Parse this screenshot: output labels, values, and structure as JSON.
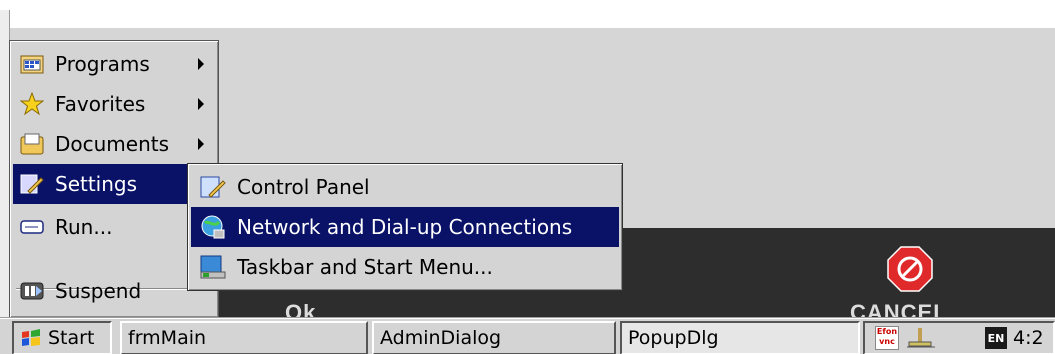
{
  "start_menu": {
    "items": [
      {
        "label": "Programs",
        "icon": "programs-icon",
        "has_submenu": true
      },
      {
        "label": "Favorites",
        "icon": "favorites-icon",
        "has_submenu": true
      },
      {
        "label": "Documents",
        "icon": "documents-icon",
        "has_submenu": true
      },
      {
        "label": "Settings",
        "icon": "settings-icon",
        "has_submenu": true,
        "selected": true
      },
      {
        "label": "Run...",
        "icon": "run-icon",
        "has_submenu": false
      },
      {
        "label": "Suspend",
        "icon": "suspend-icon",
        "has_submenu": false
      }
    ]
  },
  "settings_submenu": {
    "items": [
      {
        "label": "Control Panel",
        "icon": "control-panel-icon"
      },
      {
        "label": "Network and Dial-up Connections",
        "icon": "network-icon",
        "selected": true
      },
      {
        "label": "Taskbar and Start Menu...",
        "icon": "taskbar-icon"
      }
    ]
  },
  "taskbar": {
    "start_label": "Start",
    "buttons": [
      {
        "label": "frmMain"
      },
      {
        "label": "AdminDialog"
      },
      {
        "label": "PopupDlg",
        "pressed": true
      }
    ],
    "tray": {
      "efon_label": "Efon vnc",
      "input_language": "EN",
      "clock": "4:2"
    }
  },
  "desktop": {
    "partial_text_left": "Ok",
    "partial_text_right": "CANCEL"
  },
  "colors": {
    "selection": "#0a1268",
    "menu_bg": "#d4d4d4",
    "stop_red": "#e0292b"
  }
}
